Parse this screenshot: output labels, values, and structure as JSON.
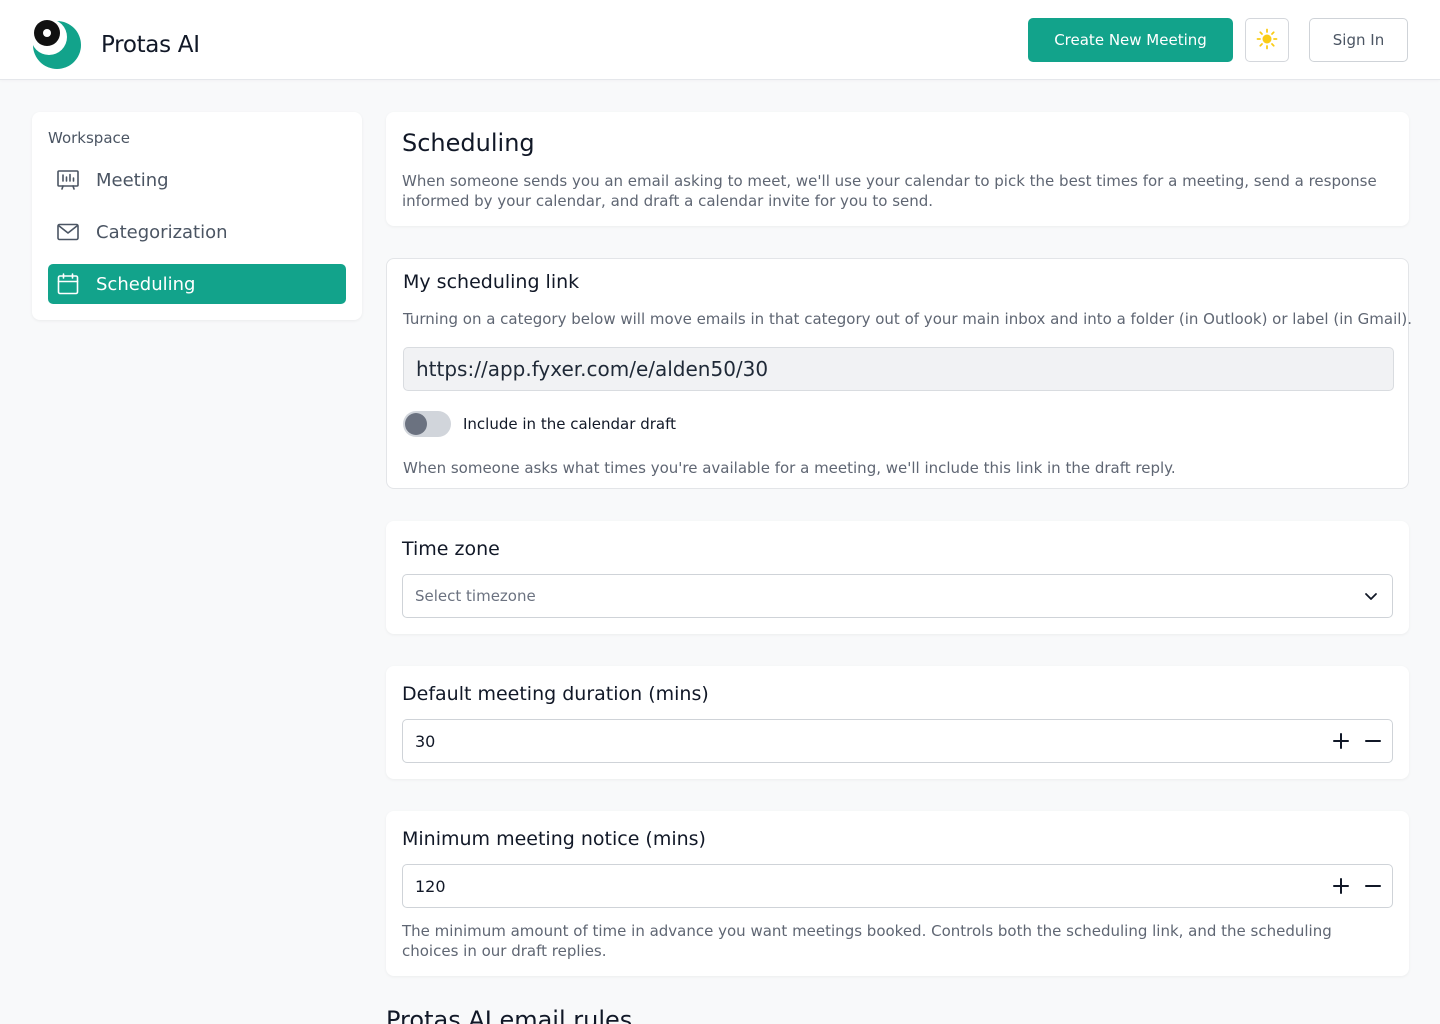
{
  "header": {
    "brand": "Protas AI",
    "create_label": "Create New Meeting",
    "theme_icon": "sun-icon",
    "signin_label": "Sign In"
  },
  "colors": {
    "accent": "#12a38b",
    "sun": "#facc15"
  },
  "sidebar": {
    "heading": "Workspace",
    "items": [
      {
        "label": "Meeting",
        "icon": "meeting-board-icon",
        "active": false
      },
      {
        "label": "Categorization",
        "icon": "mail-icon",
        "active": false
      },
      {
        "label": "Scheduling",
        "icon": "calendar-icon",
        "active": true
      }
    ]
  },
  "scheduling": {
    "title": "Scheduling",
    "description": "When someone sends you an email asking to meet, we'll use your calendar to pick the best times for a meeting, send a response informed by your calendar, and draft a calendar invite for you to send."
  },
  "link_section": {
    "title": "My scheduling link",
    "description": "Turning on a category below will move emails in that category out of your main inbox and into a folder (in Outlook) or label (in Gmail).",
    "link_value": "https://app.fyxer.com/e/alden50/30",
    "toggle_label": "Include in the calendar draft",
    "toggle_on": false,
    "note": "When someone asks what times you're available for a meeting, we'll include this link in the draft reply."
  },
  "timezone": {
    "title": "Time zone",
    "placeholder": "Select timezone"
  },
  "duration": {
    "title": "Default meeting duration (mins)",
    "value": "30"
  },
  "notice": {
    "title": "Minimum meeting notice (mins)",
    "value": "120",
    "description": "The minimum amount of time in advance you want meetings booked. Controls both the scheduling link, and the scheduling choices in our draft replies."
  },
  "rules": {
    "title": "Protas AI email rules"
  }
}
